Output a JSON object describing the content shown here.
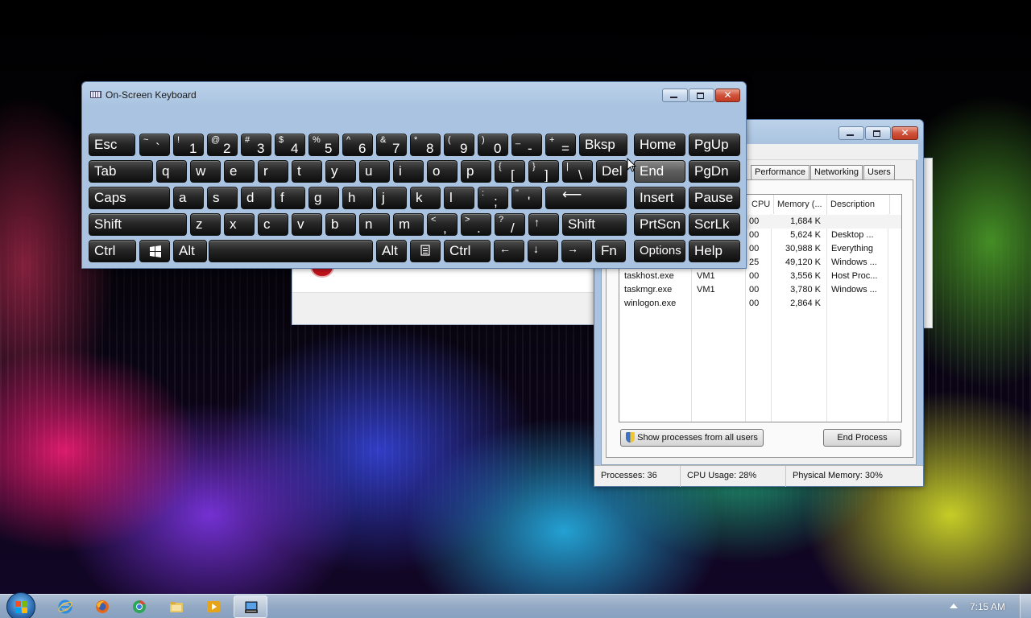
{
  "keyboard_window": {
    "title": "On-Screen Keyboard",
    "rows": [
      [
        {
          "id": "esc",
          "label": "Esc"
        },
        {
          "id": "tilde",
          "shift": "~",
          "main": "`"
        },
        {
          "id": "1",
          "shift": "!",
          "main": "1"
        },
        {
          "id": "2",
          "shift": "@",
          "main": "2"
        },
        {
          "id": "3",
          "shift": "#",
          "main": "3"
        },
        {
          "id": "4",
          "shift": "$",
          "main": "4"
        },
        {
          "id": "5",
          "shift": "%",
          "main": "5"
        },
        {
          "id": "6",
          "shift": "^",
          "main": "6"
        },
        {
          "id": "7",
          "shift": "&",
          "main": "7"
        },
        {
          "id": "8",
          "shift": "*",
          "main": "8"
        },
        {
          "id": "9",
          "shift": "(",
          "main": "9"
        },
        {
          "id": "0",
          "shift": ")",
          "main": "0"
        },
        {
          "id": "minus",
          "shift": "_",
          "main": "-"
        },
        {
          "id": "equals",
          "shift": "+",
          "main": "="
        },
        {
          "id": "bksp",
          "label": "Bksp"
        }
      ],
      [
        {
          "id": "tab",
          "label": "Tab"
        },
        {
          "id": "q",
          "label": "q"
        },
        {
          "id": "w",
          "label": "w"
        },
        {
          "id": "e",
          "label": "e"
        },
        {
          "id": "r",
          "label": "r"
        },
        {
          "id": "t",
          "label": "t"
        },
        {
          "id": "y",
          "label": "y"
        },
        {
          "id": "u",
          "label": "u"
        },
        {
          "id": "i",
          "label": "i"
        },
        {
          "id": "o",
          "label": "o"
        },
        {
          "id": "p",
          "label": "p"
        },
        {
          "id": "lbracket",
          "shift": "{",
          "main": "["
        },
        {
          "id": "rbracket",
          "shift": "}",
          "main": "]"
        },
        {
          "id": "backslash",
          "shift": "|",
          "main": "\\"
        },
        {
          "id": "del",
          "label": "Del"
        }
      ],
      [
        {
          "id": "caps",
          "label": "Caps"
        },
        {
          "id": "a",
          "label": "a"
        },
        {
          "id": "s",
          "label": "s"
        },
        {
          "id": "d",
          "label": "d"
        },
        {
          "id": "f",
          "label": "f"
        },
        {
          "id": "g",
          "label": "g"
        },
        {
          "id": "h",
          "label": "h"
        },
        {
          "id": "j",
          "label": "j"
        },
        {
          "id": "k",
          "label": "k"
        },
        {
          "id": "l",
          "label": "l"
        },
        {
          "id": "semicolon",
          "shift": ":",
          "main": ";"
        },
        {
          "id": "quote",
          "shift": "\"",
          "main": "'"
        },
        {
          "id": "enter",
          "label": "⟵"
        }
      ],
      [
        {
          "id": "lshift",
          "label": "Shift"
        },
        {
          "id": "z",
          "label": "z"
        },
        {
          "id": "x",
          "label": "x"
        },
        {
          "id": "c",
          "label": "c"
        },
        {
          "id": "v",
          "label": "v"
        },
        {
          "id": "b",
          "label": "b"
        },
        {
          "id": "n",
          "label": "n"
        },
        {
          "id": "m",
          "label": "m"
        },
        {
          "id": "comma",
          "shift": "<",
          "main": ","
        },
        {
          "id": "period",
          "shift": ">",
          "main": "."
        },
        {
          "id": "slash",
          "shift": "?",
          "main": "/"
        },
        {
          "id": "up",
          "label": "↑"
        },
        {
          "id": "rshift",
          "label": "Shift"
        }
      ],
      [
        {
          "id": "lctrl",
          "label": "Ctrl"
        },
        {
          "id": "win",
          "label": ""
        },
        {
          "id": "lalt",
          "label": "Alt"
        },
        {
          "id": "space",
          "label": ""
        },
        {
          "id": "ralt",
          "label": "Alt"
        },
        {
          "id": "menu",
          "label": ""
        },
        {
          "id": "rctrl",
          "label": "Ctrl"
        },
        {
          "id": "left",
          "label": "←"
        },
        {
          "id": "down",
          "label": "↓"
        },
        {
          "id": "right",
          "label": "→"
        },
        {
          "id": "fn",
          "label": "Fn"
        }
      ]
    ],
    "nav_keys": [
      [
        "Home",
        "PgUp"
      ],
      [
        "End",
        "PgDn"
      ],
      [
        "Insert",
        "Pause"
      ],
      [
        "PrtScn",
        "ScrLk"
      ],
      [
        "Options",
        "Help"
      ]
    ]
  },
  "task_manager": {
    "tabs": [
      "Performance",
      "Networking",
      "Users"
    ],
    "columns": [
      "CPU",
      "Memory (...",
      "Description"
    ],
    "rows": [
      {
        "name": "",
        "user": "",
        "cpu": "00",
        "memory": "1,684 K",
        "description": ""
      },
      {
        "name": "",
        "user": "",
        "cpu": "00",
        "memory": "5,624 K",
        "description": "Desktop ..."
      },
      {
        "name": "",
        "user": "",
        "cpu": "00",
        "memory": "30,988 K",
        "description": "Everything"
      },
      {
        "name": "",
        "user": "",
        "cpu": "25",
        "memory": "49,120 K",
        "description": "Windows ..."
      },
      {
        "name": "taskhost.exe",
        "user": "VM1",
        "cpu": "00",
        "memory": "3,556 K",
        "description": "Host Proc..."
      },
      {
        "name": "taskmgr.exe",
        "user": "VM1",
        "cpu": "00",
        "memory": "3,780 K",
        "description": "Windows ..."
      },
      {
        "name": "winlogon.exe",
        "user": "",
        "cpu": "00",
        "memory": "2,864 K",
        "description": ""
      }
    ],
    "show_all_button": "Show processes from all users",
    "end_process_button": "End Process",
    "status": {
      "processes": "Processes: 36",
      "cpu": "CPU Usage: 28%",
      "memory": "Physical Memory: 30%"
    }
  },
  "taskbar": {
    "pinned": [
      "internet-explorer-icon",
      "firefox-icon",
      "chrome-icon",
      "folder-icon",
      "media-player-icon",
      "on-screen-keyboard-icon"
    ],
    "clock": "7:15 AM"
  }
}
